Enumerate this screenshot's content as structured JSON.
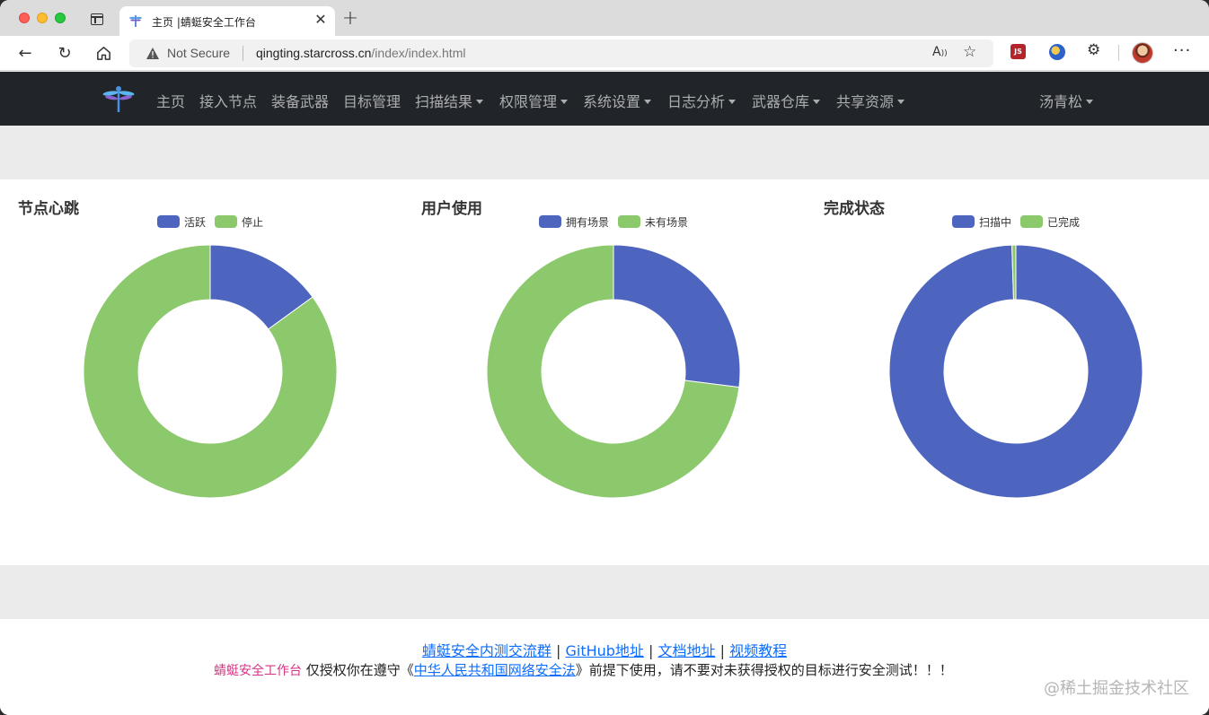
{
  "browser": {
    "tab_title": "主页 |蜻蜓安全工作台",
    "tab_close": "✕",
    "new_tab": "+",
    "security_label": "Not Secure",
    "url_host": "qingting.starcross.cn",
    "url_path": "/index/index.html",
    "ext_js_label": "JS"
  },
  "nav": {
    "items": [
      {
        "label": "主页",
        "dropdown": false
      },
      {
        "label": "接入节点",
        "dropdown": false
      },
      {
        "label": "装备武器",
        "dropdown": false
      },
      {
        "label": "目标管理",
        "dropdown": false
      },
      {
        "label": "扫描结果",
        "dropdown": true
      },
      {
        "label": "权限管理",
        "dropdown": true
      },
      {
        "label": "系统设置",
        "dropdown": true
      },
      {
        "label": "日志分析",
        "dropdown": true
      },
      {
        "label": "武器仓库",
        "dropdown": true
      },
      {
        "label": "共享资源",
        "dropdown": true
      }
    ],
    "user": "汤青松"
  },
  "colors": {
    "blue": "#4e65c0",
    "green": "#8cc86c",
    "navbar": "#212529",
    "link": "#0d6efd",
    "brand_pink": "#d63384"
  },
  "chart_data": [
    {
      "type": "pie",
      "title": "节点心跳",
      "categories": [
        "活跃",
        "停止"
      ],
      "values": [
        15,
        85
      ],
      "legend": "top-center"
    },
    {
      "type": "pie",
      "title": "用户使用",
      "categories": [
        "拥有场景",
        "未有场景"
      ],
      "values": [
        27,
        73
      ],
      "legend": "top-center"
    },
    {
      "type": "pie",
      "title": "完成状态",
      "categories": [
        "扫描中",
        "已完成"
      ],
      "values": [
        99.5,
        0.5
      ],
      "legend": "top-center"
    }
  ],
  "footer": {
    "links": [
      "蜻蜓安全内测交流群",
      "GitHub地址",
      "文档地址",
      "视频教程"
    ],
    "separator": "|",
    "brand": "蜻蜓安全工作台",
    "note_prefix": " 仅授权你在遵守《",
    "law_link": "中华人民共和国网络安全法",
    "note_suffix": "》前提下使用，请不要对未获得授权的目标进行安全测试！！！"
  },
  "watermark": "@稀土掘金技术社区"
}
